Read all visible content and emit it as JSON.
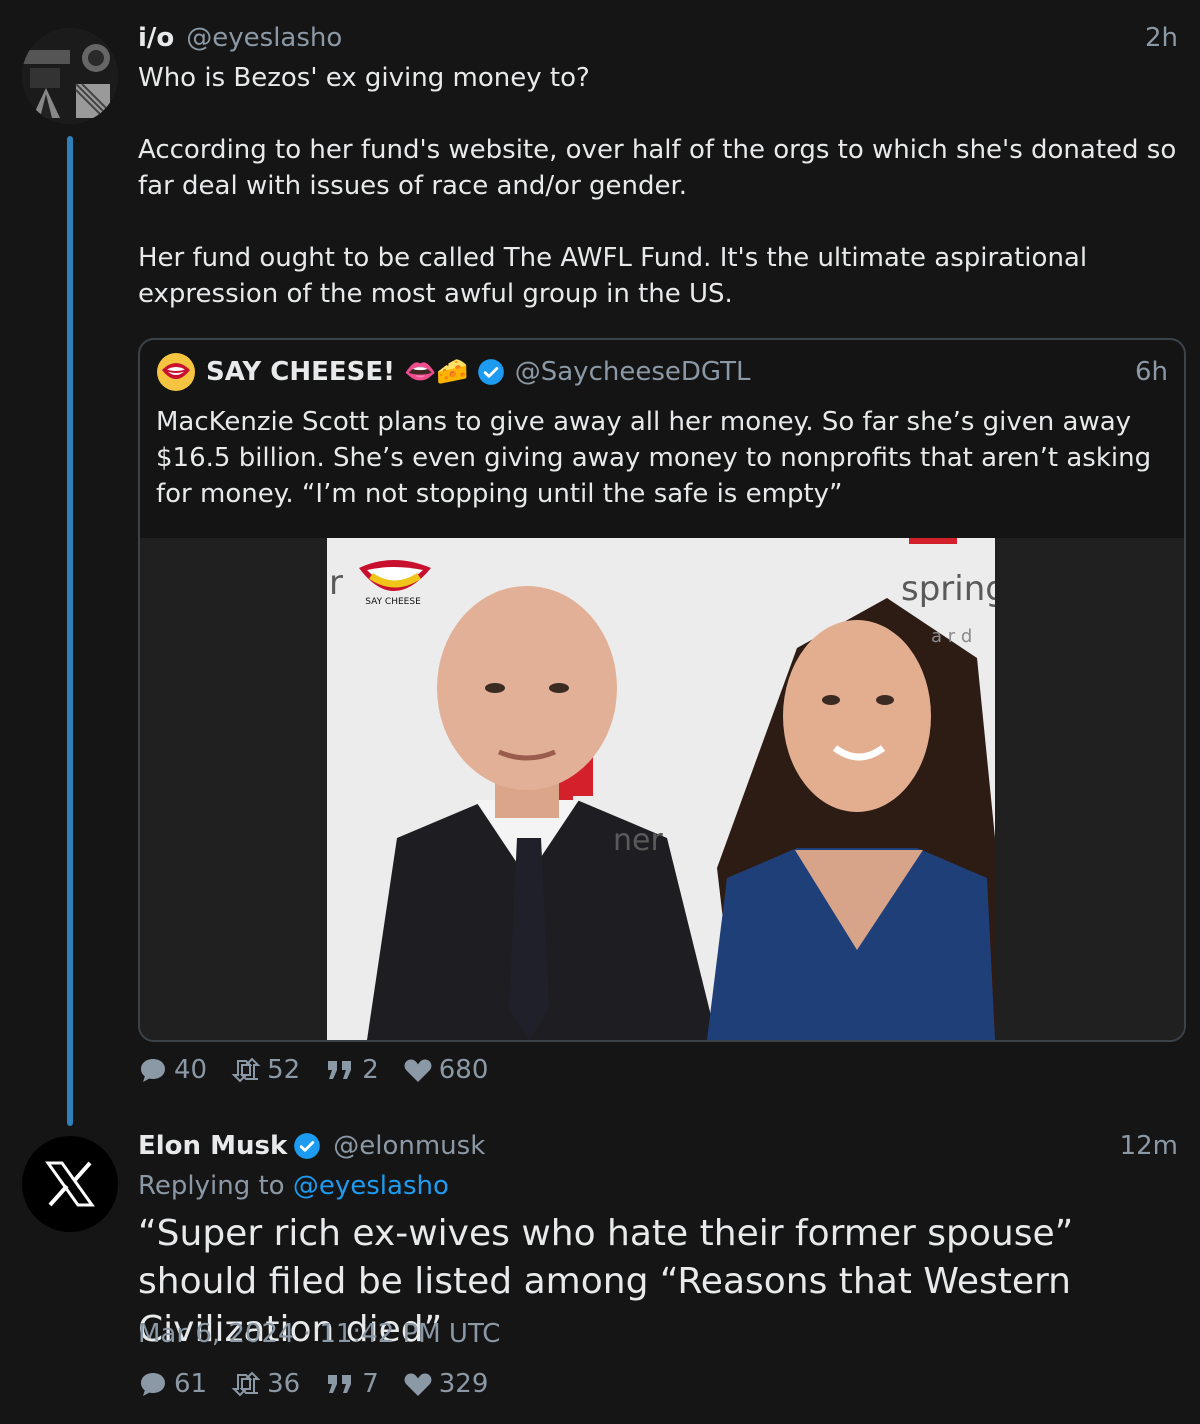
{
  "tweet1": {
    "name": "i/o",
    "handle": "@eyeslasho",
    "time": "2h",
    "body": "Who is Bezos' ex giving money to?\n\nAccording to her fund's website, over half of the orgs to which she's donated so far deal with issues of race and/or gender.\n\nHer fund ought to be called The AWFL Fund. It's the ultimate aspirational expression of the most awful group in the US.",
    "quote": {
      "name": "SAY CHEESE! 👄🧀",
      "handle": "@SaycheeseDGTL",
      "time": "6h",
      "body": "MacKenzie Scott plans to give away all her money. So far she’s given away $16.5 billion. She’s even giving away money to nonprofits that aren’t asking for money. “I’m not stopping until the safe is empty”",
      "photo_texts": [
        "r",
        "spring",
        "a r d",
        "ner"
      ],
      "watermark": "SAY CHEESE"
    },
    "stats": {
      "replies": "40",
      "retweets": "52",
      "quotes": "2",
      "likes": "680"
    }
  },
  "tweet2": {
    "name": "Elon Musk",
    "handle": "@elonmusk",
    "time": "12m",
    "replying_prefix": "Replying to",
    "replying_handle": "@eyeslasho",
    "body": "“Super rich ex-wives who hate their former spouse” should filed be listed among “Reasons that Western Civilization died”",
    "timestamp": "Mar 6, 2024 · 11:42 PM UTC",
    "stats": {
      "replies": "61",
      "retweets": "36",
      "quotes": "7",
      "likes": "329"
    }
  },
  "colors": {
    "accent": "#1d9bf0",
    "thread": "#2f7fb8",
    "muted": "#8b98a5",
    "verified": "#1d9bf0"
  }
}
